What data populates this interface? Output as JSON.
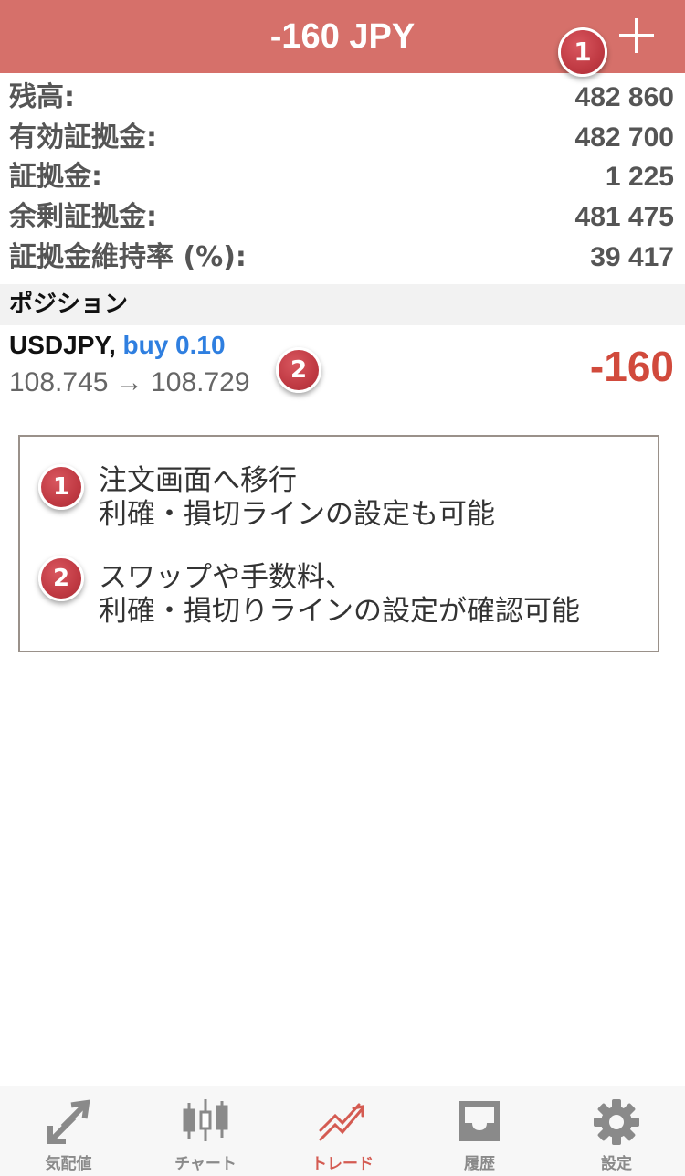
{
  "header": {
    "title": "-160 JPY",
    "badge": "1"
  },
  "account": [
    {
      "label": "残高:",
      "value": "482 860"
    },
    {
      "label": "有効証拠金:",
      "value": "482 700"
    },
    {
      "label": "証拠金:",
      "value": "1 225"
    },
    {
      "label": "余剰証拠金:",
      "value": "481 475"
    },
    {
      "label": "証拠金維持率 (%):",
      "value": "39 417"
    }
  ],
  "positions": {
    "section_label": "ポジション",
    "items": [
      {
        "symbol": "USDJPY,",
        "side": "buy 0.10",
        "prices": "108.745 → 108.729",
        "profit": "-160",
        "badge": "2"
      }
    ]
  },
  "notes": [
    {
      "badge": "1",
      "line1": "注文画面へ移行",
      "line2": "利確・損切ラインの設定も可能"
    },
    {
      "badge": "2",
      "line1": "スワップや手数料、",
      "line2": "利確・損切りラインの設定が確認可能"
    }
  ],
  "tabbar": {
    "items": [
      {
        "label": "気配値",
        "icon": "quotes-arrows-icon"
      },
      {
        "label": "チャート",
        "icon": "candlestick-chart-icon"
      },
      {
        "label": "トレード",
        "icon": "trade-trend-icon",
        "active": true
      },
      {
        "label": "履歴",
        "icon": "history-inbox-icon"
      },
      {
        "label": "設定",
        "icon": "gear-icon"
      }
    ]
  },
  "colors": {
    "header_bg": "#d6706a",
    "profit_negative": "#d14a3c",
    "side_buy": "#2f7fe0",
    "tab_active": "#d45b52",
    "badge": "#c03a43"
  }
}
